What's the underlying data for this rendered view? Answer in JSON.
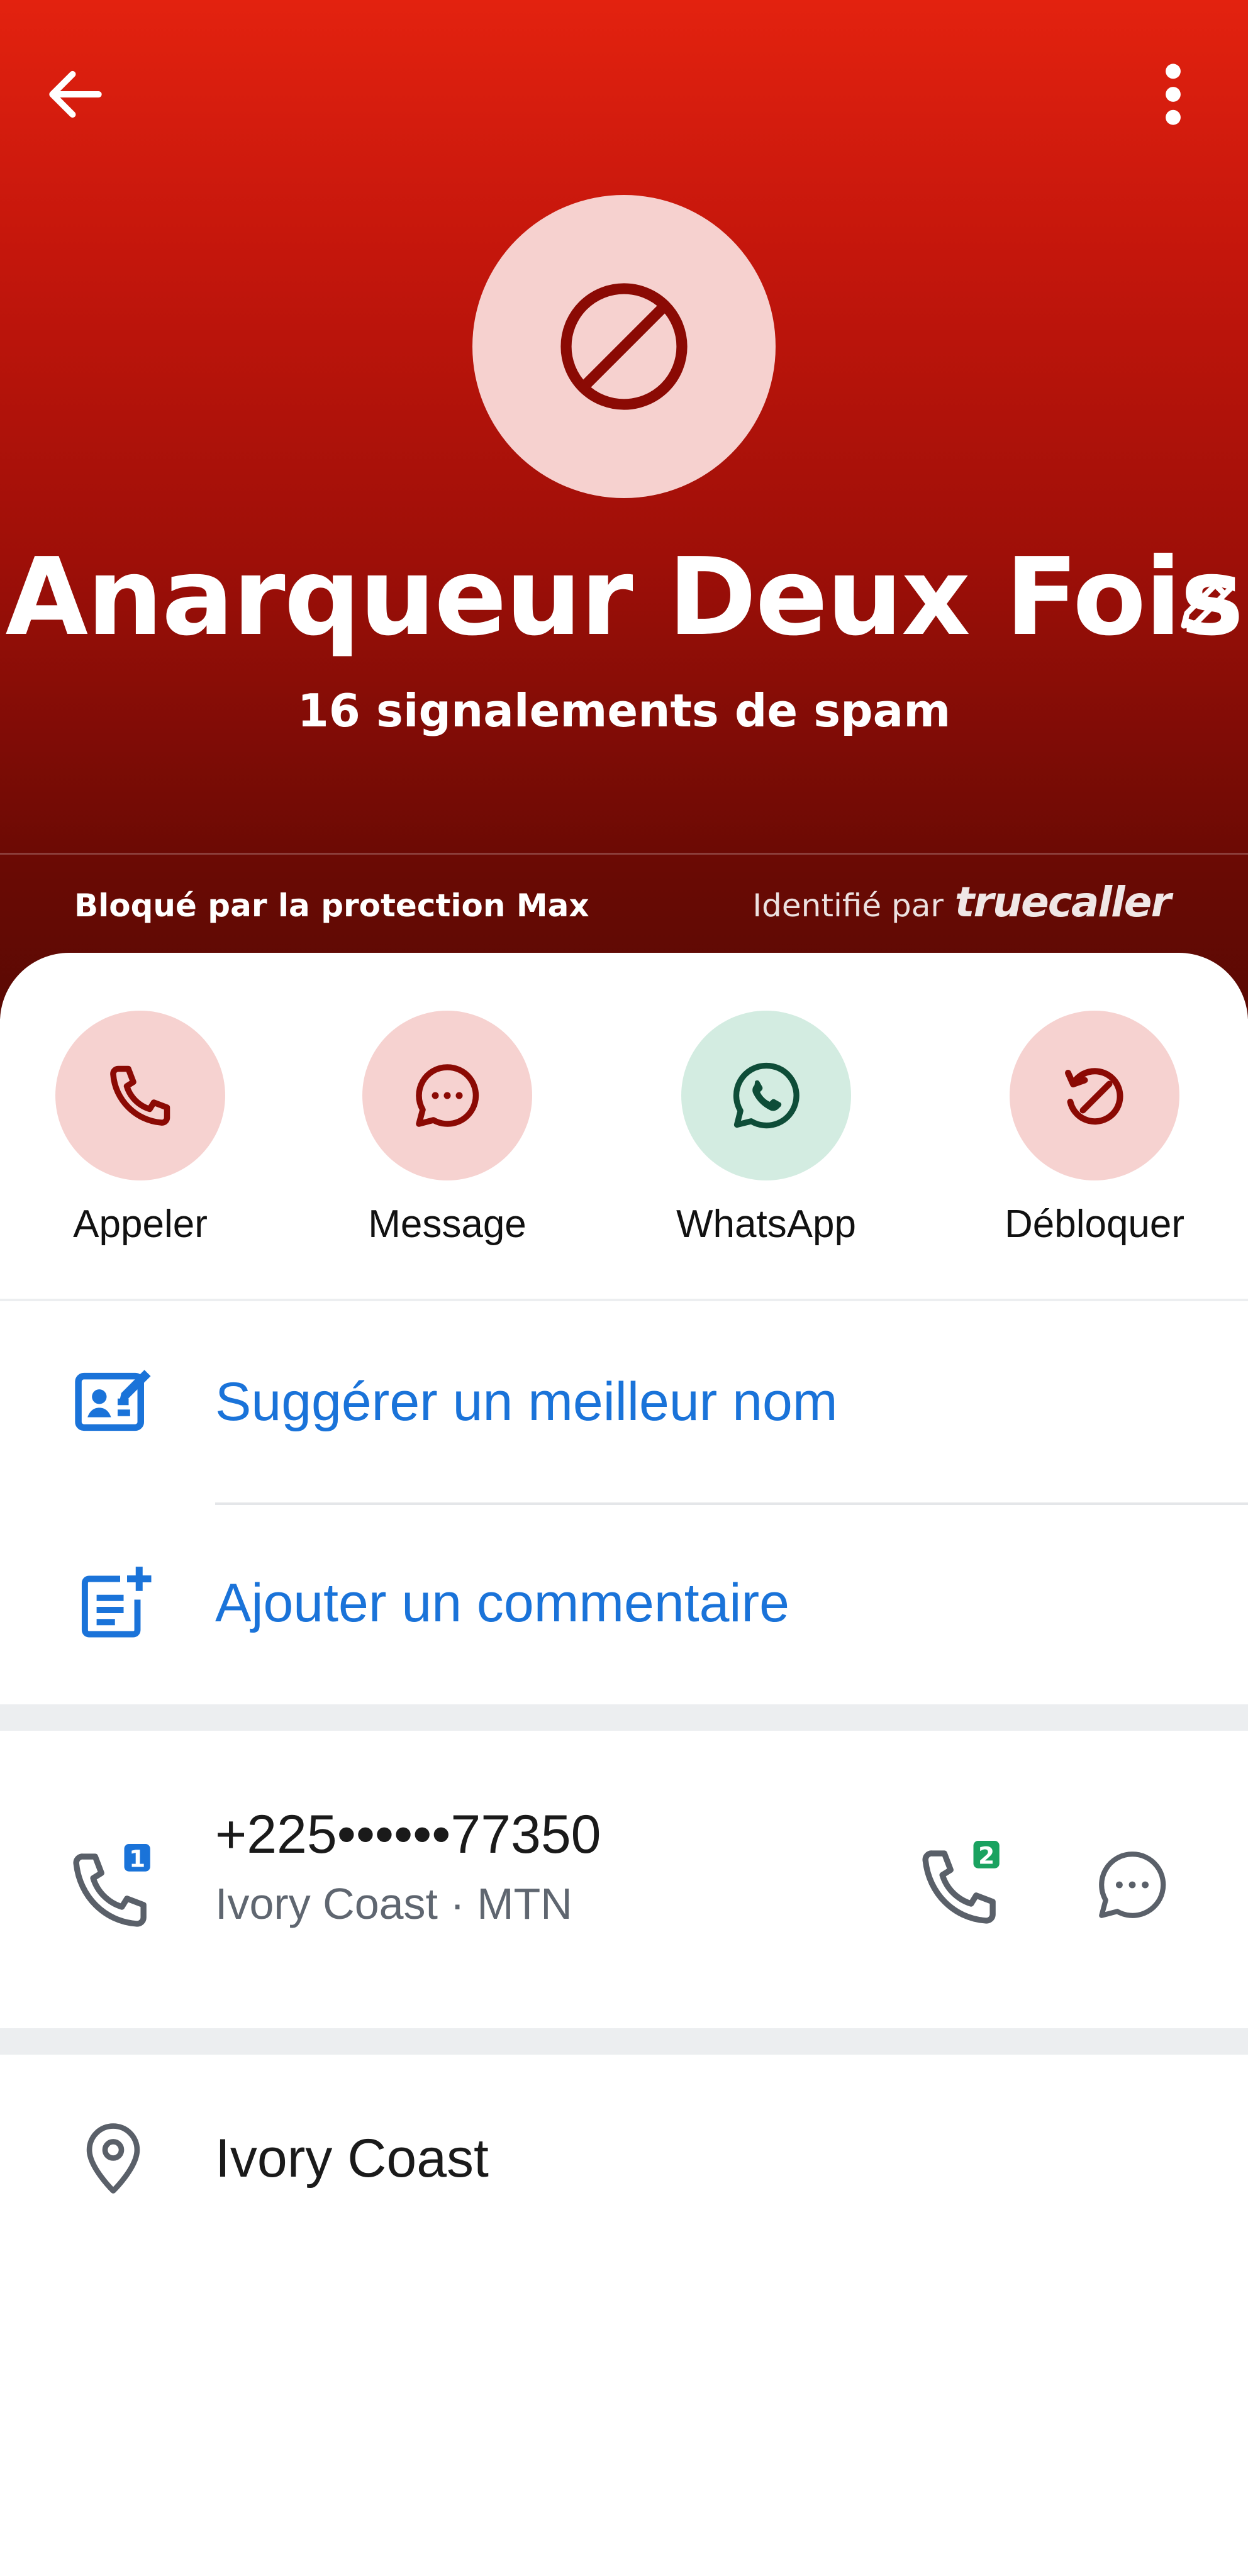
{
  "header": {
    "name": "Anarqueur Deux Fois",
    "spam_reports": "16 signalements de spam",
    "blocked_by": "Bloqué par la protection Max",
    "identified_prefix": "Identifié par",
    "brand": "truecaller"
  },
  "actions": [
    {
      "label": "Appeler",
      "icon": "phone-icon"
    },
    {
      "label": "Message",
      "icon": "chat-bubble-icon"
    },
    {
      "label": "WhatsApp",
      "icon": "whatsapp-icon"
    },
    {
      "label": "Débloquer",
      "icon": "unblock-icon"
    }
  ],
  "links": {
    "suggest_name": "Suggérer un meilleur nom",
    "add_comment": "Ajouter un commentaire"
  },
  "phone": {
    "number": "+225••••••77350",
    "meta": "Ivory Coast · MTN",
    "sim1_badge": "1",
    "sim2_badge": "2"
  },
  "location": {
    "text": "Ivory Coast"
  },
  "colors": {
    "header_top": "#e3220f",
    "header_bottom": "#5a0903",
    "avatar_bg": "#f6d1cf",
    "accent_dark_red": "#8b0a04",
    "link_blue": "#1a73d9",
    "whatsapp_bg": "#d3ece1",
    "whatsapp_icon": "#0e4d38",
    "sim2_green": "#1aa260"
  }
}
